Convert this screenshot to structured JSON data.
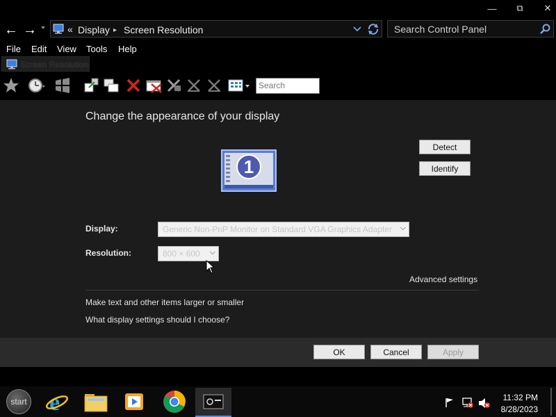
{
  "window": {
    "minimize_glyph": "—",
    "restore_glyph": "⧉",
    "close_glyph": "✕"
  },
  "address": {
    "back_glyph": "←",
    "forward_glyph": "→",
    "overflow": "«",
    "crumbs": [
      "Display",
      "Screen Resolution"
    ],
    "separator": "▸",
    "search_placeholder": "Search Control Panel"
  },
  "menu": [
    "File",
    "Edit",
    "View",
    "Tools",
    "Help"
  ],
  "tab": {
    "label": "Screen Resolution"
  },
  "toolbar": {
    "search_placeholder": "Search"
  },
  "main": {
    "heading": "Change the appearance of your display",
    "detect_label": "Detect",
    "identify_label": "Identify",
    "monitor_number": "1",
    "display_label": "Display:",
    "display_value": "Generic Non-PnP Monitor on Standard VGA Graphics Adapter",
    "resolution_label": "Resolution:",
    "resolution_value": "800 × 600",
    "advanced_link": "Advanced settings",
    "link_text_size": "Make text and other items larger or smaller",
    "link_choose": "What display settings should I choose?"
  },
  "buttons": {
    "ok": "OK",
    "cancel": "Cancel",
    "apply": "Apply"
  },
  "taskbar": {
    "start_label": "start",
    "time": "11:32 PM",
    "date": "8/28/2023"
  },
  "colors": {
    "accent_blue": "#2f7fd6",
    "monitor_fill": "#5b7bd3"
  }
}
